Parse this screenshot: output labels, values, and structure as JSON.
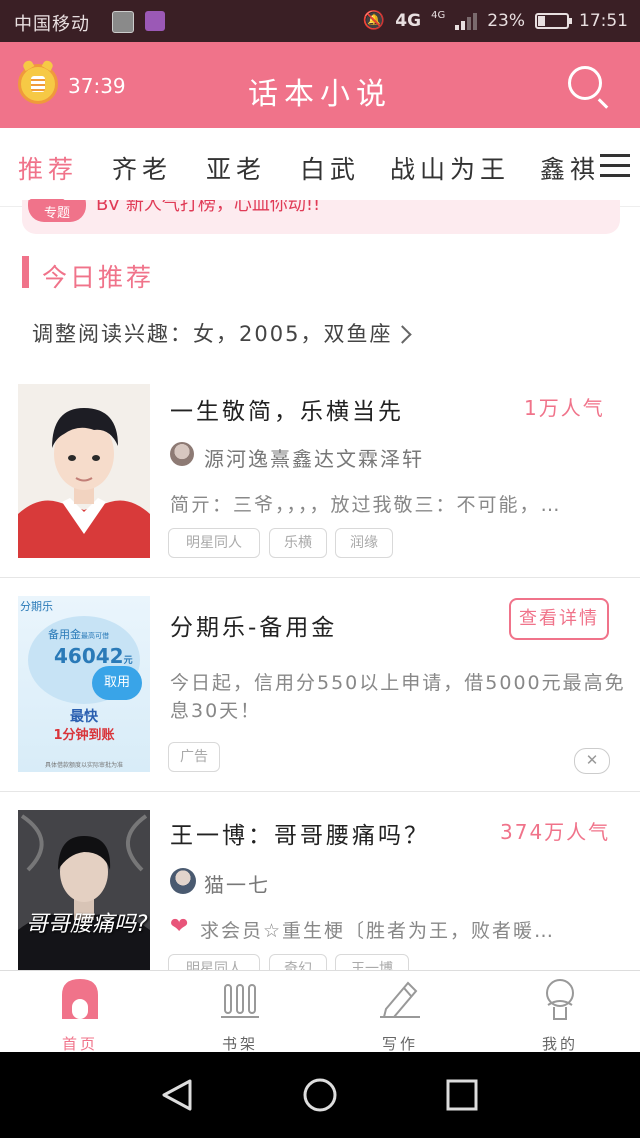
{
  "status_bar": {
    "carrier": "中国移动",
    "network": "4G",
    "network_small": "4G",
    "battery": "23%",
    "battery_level": 0.23,
    "time": "17:51"
  },
  "header": {
    "timer": "37:39",
    "title": "话本小说",
    "icons": [
      "alarm-clock-coins-icon",
      "search-icon"
    ],
    "color": "#f0738a"
  },
  "tabs": {
    "items": [
      "推荐",
      "齐老",
      "亚老",
      "白武",
      "战山为王",
      "鑫祺"
    ],
    "active_index": 0
  },
  "marquee": {
    "badge": "专题",
    "text": "BV 新人气打榜，心血你动!!"
  },
  "section": {
    "title": "今日推荐",
    "interest": "调整阅读兴趣：女，2005，双鱼座"
  },
  "cards": [
    {
      "title": "一生敬简，乐横当先",
      "popularity": "1万人气",
      "author": "源河逸熹鑫达文霖泽轩",
      "description": "简亓：三爷，，，，放过我敬三：不可能，…",
      "tags": [
        "明星同人",
        "乐横",
        "润缘"
      ]
    },
    {
      "title": "王一博：哥哥腰痛吗？",
      "popularity": "374万人气",
      "author": "猫一七",
      "description": "求会员☆重生梗〔胜者为王，败者暖…",
      "tags": [
        "明星同人",
        "奇幻",
        "王一博"
      ],
      "cover_text": "哥哥腰痛吗?"
    }
  ],
  "ad": {
    "title": "分期乐-备用金",
    "detail_button": "查看详情",
    "description_line1": "今日起，信用分550以上申请，借5000元最高免",
    "description_line2": "息30天！",
    "tag": "广告",
    "close": "✕",
    "cover": {
      "brand": "分期乐",
      "label": "备用金",
      "sub_label": "最高可借",
      "amount": "46042",
      "unit": "元",
      "button": "取用",
      "headline1": "最快",
      "headline2": "1分钟到账",
      "footnote": "具体借款额度以实际审批为准"
    }
  },
  "bottom_nav": {
    "items": [
      {
        "label": "首页",
        "icon": "home-arch-icon"
      },
      {
        "label": "书架",
        "icon": "bookshelf-icon"
      },
      {
        "label": "写作",
        "icon": "pen-icon"
      },
      {
        "label": "我的",
        "icon": "profile-icon"
      }
    ],
    "active_index": 0
  }
}
